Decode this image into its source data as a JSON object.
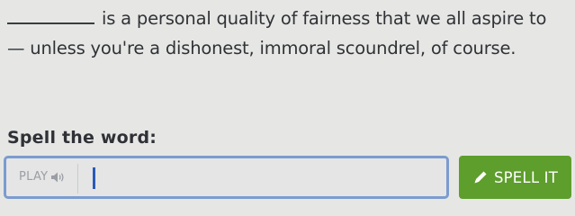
{
  "sentence": {
    "line1": "is a personal quality of fairness that we all aspire to",
    "line2": "— unless you're a dishonest, immoral scoundrel, of course."
  },
  "prompt": {
    "label": "Spell the word:"
  },
  "answer": {
    "play_label": "PLAY",
    "value": "",
    "placeholder": ""
  },
  "spell_button": {
    "label": "SPELL IT"
  },
  "colors": {
    "input_border": "#7b9ccf",
    "spell_button": "#5e9e2c",
    "caret": "#2a5ab8"
  },
  "icons": {
    "play": "speaker-icon",
    "spell": "pencil-icon"
  }
}
